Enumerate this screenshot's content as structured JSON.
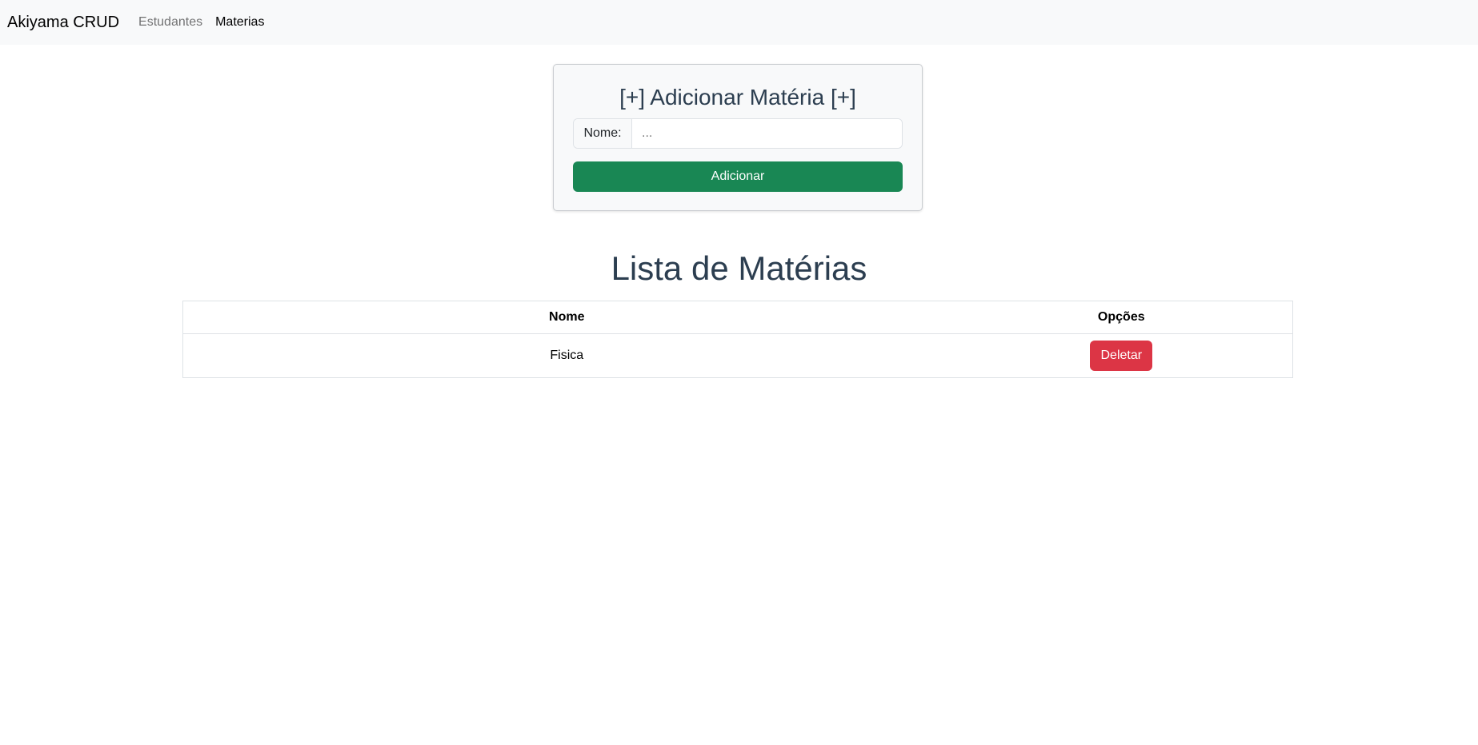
{
  "navbar": {
    "brand": "Akiyama CRUD",
    "links": [
      {
        "label": "Estudantes",
        "active": false
      },
      {
        "label": "Materias",
        "active": true
      }
    ]
  },
  "add_form": {
    "title": "[+] Adicionar Matéria [+]",
    "name_label": "Nome:",
    "name_placeholder": "...",
    "name_value": "",
    "submit_label": "Adicionar"
  },
  "list": {
    "title": "Lista de Matérias",
    "columns": [
      "Nome",
      "Opções"
    ],
    "rows": [
      {
        "nome": "Fisica",
        "action_label": "Deletar"
      }
    ]
  },
  "colors": {
    "success": "#198754",
    "danger": "#dc3545",
    "heading": "#2c3e50",
    "navbar_bg": "#f8f9fa"
  }
}
